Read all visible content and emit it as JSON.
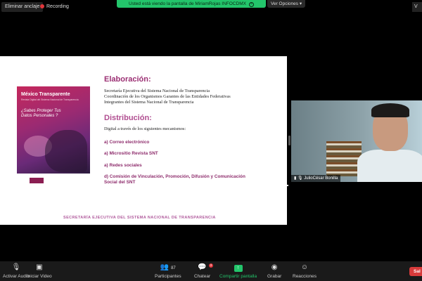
{
  "topbar": {
    "unpin_label": "Eliminar anclaje",
    "recording_label": "Recording",
    "share_banner": "Usted está viendo la pantalla de MiriamRojas INFOCDMX",
    "view_options": "Ver Opciones",
    "right_label": "V"
  },
  "slide": {
    "cover": {
      "title": "México Transparente",
      "subtitle": "Revista Digital del Sistema Nacional de Transparencia",
      "question": "¿Sabes Proteger Tus Datos Personales ?"
    },
    "elaboracion_heading": "Elaboración:",
    "elaboracion_lines": [
      "Secretaría Ejecutiva del  Sistema Nacional de Transparencia",
      "Coordinación  de  los Organismos Garantes de las Entidades Federativas",
      "Integrantes del Sistema Nacional de Transparencia"
    ],
    "distribucion_heading": "Distribución:",
    "distribucion_intro": "Digital a través de los siguientes mecanismos:",
    "items": [
      "a)  Correo electrónico",
      "a)  Micrositio Revista SNT",
      "a)  Redes sociales",
      "d)  Comisión de  Vinculación, Promoción, Difusión y Comunicación",
      "Social del SNT"
    ],
    "footer": "SECRETARÍA EJECUTIVA DEL SISTEMA NACIONAL DE TRANSPARENCIA"
  },
  "video": {
    "participant_name": "JulioCésar Bonilla"
  },
  "toolbar": {
    "unmute": "Activar Audio",
    "start_video": "Iniciar Video",
    "participants": "Participantes",
    "participants_count": "87",
    "chat": "Chatear",
    "chat_badge": "3",
    "share": "Compartir pantalla",
    "record": "Grabar",
    "reactions": "Reacciones",
    "leave": "Sal"
  }
}
